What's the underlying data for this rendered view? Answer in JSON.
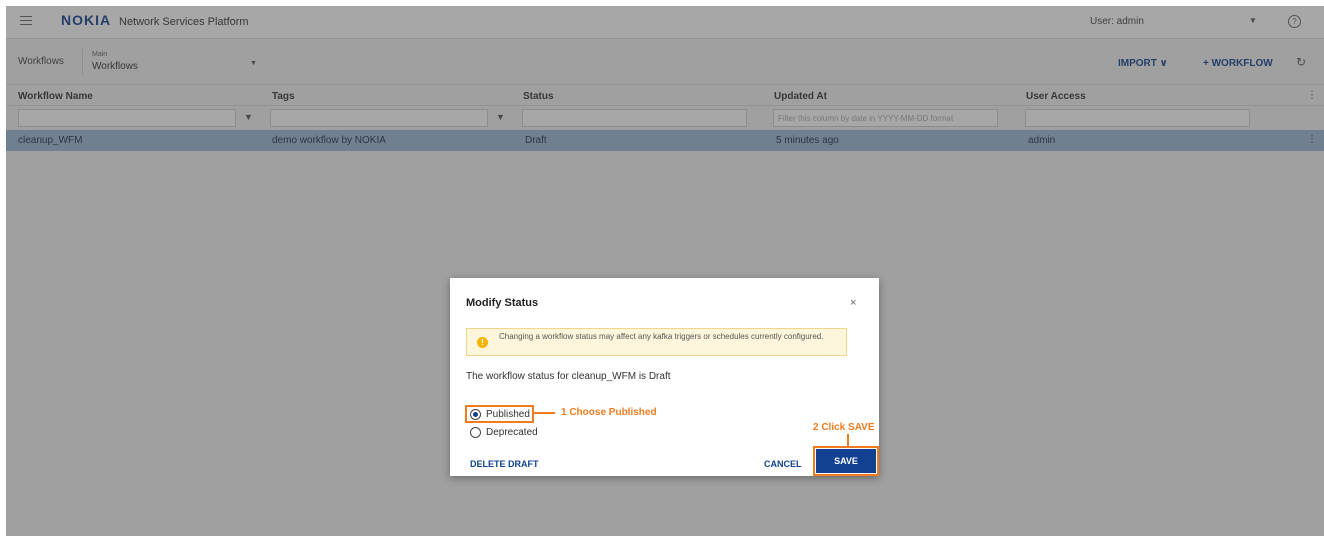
{
  "topbar": {
    "logo": "NOKIA",
    "app_title": "Network Services Platform",
    "user_label": "User: admin",
    "user_dropdown_icon": "caret-down-icon",
    "help_icon": "help-icon"
  },
  "toolbar": {
    "workflows_label": "Workflows",
    "main_small": "Main",
    "main_label": "Workflows",
    "import_label": "IMPORT ∨",
    "add_workflow_label": "+ WORKFLOW",
    "refresh_icon": "refresh-icon"
  },
  "table": {
    "columns": [
      "Workflow Name",
      "Tags",
      "Status",
      "Updated At",
      "User Access"
    ],
    "filter_placeholder_updated": "Filter this column by date in YYYY-MM-DD format",
    "rows": [
      {
        "name": "cleanup_WFM",
        "tags": "demo workflow by NOKIA",
        "status": "Draft",
        "updated": "5 minutes ago",
        "access": "admin"
      }
    ]
  },
  "dialog": {
    "title": "Modify Status",
    "close_icon": "close-icon",
    "warning": "Changing a workflow status may affect any kafka triggers or schedules currently configured.",
    "status_text": "The workflow status for cleanup_WFM is Draft",
    "options": [
      {
        "label": "Published",
        "checked": true
      },
      {
        "label": "Deprecated",
        "checked": false
      }
    ],
    "callout_1": "1 Choose Published",
    "callout_2": "2 Click SAVE",
    "delete_label": "DELETE DRAFT",
    "cancel_label": "CANCEL",
    "save_label": "SAVE"
  },
  "colors": {
    "brand": "#124191",
    "selected_row": "#9db8d6",
    "annotation": "#f07c20",
    "warning_bg": "#fdf6dc"
  }
}
